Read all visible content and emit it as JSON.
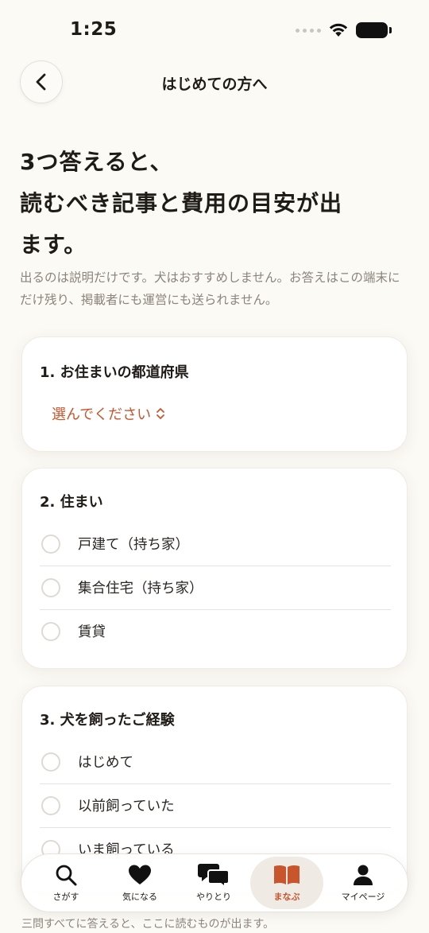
{
  "status": {
    "time": "1:25"
  },
  "nav": {
    "title": "はじめての方へ"
  },
  "headline": [
    "3つ答えると、",
    "読むべき記事と費用の目安が出",
    "ます。"
  ],
  "intro": "出るのは説明だけです。犬はおすすめしません。お答えはこの端末にだけ残り、掲載者にも運営にも送られません。",
  "questions": [
    {
      "title": "1. お住まいの都道府県",
      "select_value": "選んでください"
    },
    {
      "title": "2. 住まい",
      "options": [
        "戸建て（持ち家）",
        "集合住宅（持ち家）",
        "賃貸"
      ]
    },
    {
      "title": "3. 犬を飼ったご経験",
      "options": [
        "はじめて",
        "以前飼っていた",
        "いま飼っている"
      ]
    }
  ],
  "tabs": [
    {
      "label": "さがす",
      "icon": "search-icon"
    },
    {
      "label": "気になる",
      "icon": "heart-icon"
    },
    {
      "label": "やりとり",
      "icon": "chat-bubbles-icon"
    },
    {
      "label": "まなぶ",
      "icon": "book-icon",
      "active": true
    },
    {
      "label": "マイページ",
      "icon": "person-icon"
    }
  ],
  "footer_note": "三問すべてに答えると、ここに読むものが出ます。",
  "colors": {
    "accent": "#c8552c",
    "background": "#fcfaf5",
    "muted_text": "#8a847c"
  }
}
